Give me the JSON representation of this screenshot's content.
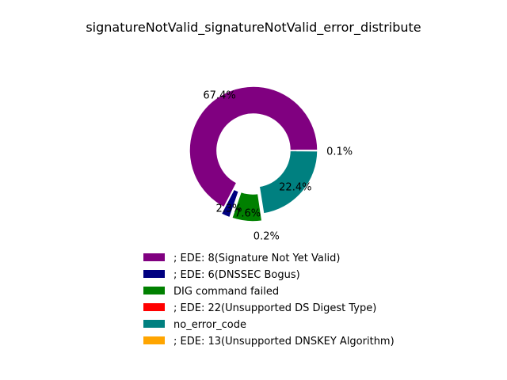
{
  "chart_data": {
    "type": "pie",
    "donut": true,
    "title": "signatureNotValid_signatureNotValid_error_distribute",
    "legend_placement": "bottom-center",
    "slices": [
      {
        "label": "; EDE: 8(Signature Not Yet Valid)",
        "value": 67.4,
        "pct_label": "67.4%",
        "color": "#800080",
        "exploded": false
      },
      {
        "label": "; EDE: 6(DNSSEC Bogus)",
        "value": 2.3,
        "pct_label": "2.3%",
        "color": "#000080",
        "exploded": true
      },
      {
        "label": "DIG command failed",
        "value": 7.6,
        "pct_label": "7.6%",
        "color": "#008000",
        "exploded": true
      },
      {
        "label": "; EDE: 22(Unsupported DS Digest Type)",
        "value": 0.2,
        "pct_label": "0.2%",
        "color": "#ff0000",
        "exploded": true
      },
      {
        "label": "no_error_code",
        "value": 22.4,
        "pct_label": "22.4%",
        "color": "#008080",
        "exploded": false
      },
      {
        "label": "; EDE: 13(Unsupported DNSKEY Algorithm)",
        "value": 0.1,
        "pct_label": "0.1%",
        "color": "#ffa500",
        "exploded": true
      }
    ]
  }
}
